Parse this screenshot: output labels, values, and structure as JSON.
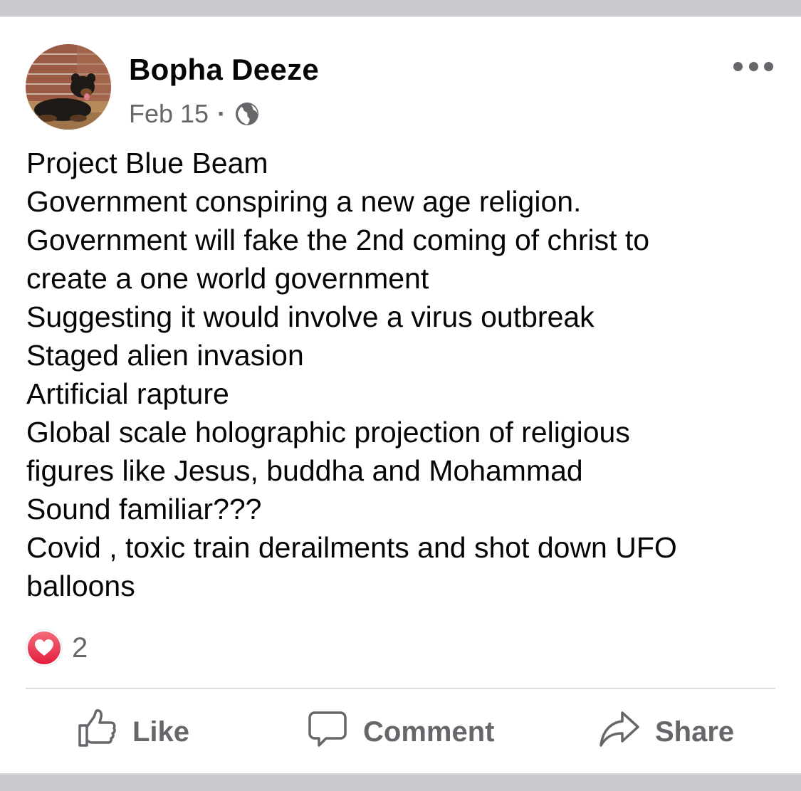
{
  "post": {
    "author": "Bopha Deeze",
    "date": "Feb 15",
    "separator": "·",
    "audience_icon": "globe-icon",
    "more_icon": "more-options-icon",
    "body_lines": [
      "Project Blue Beam",
      "Government conspiring a new age religion.",
      "Government will fake the 2nd coming of christ to",
      "create a one world government",
      "Suggesting it would involve a virus outbreak",
      "Staged alien invasion",
      "Artificial rapture",
      "Global scale holographic projection of religious",
      "figures like Jesus, buddha and Mohammad",
      "Sound familiar???",
      "Covid , toxic train derailments and shot down UFO",
      "balloons"
    ],
    "reactions": {
      "icon": "heart-icon",
      "count": "2"
    }
  },
  "actions": {
    "like_label": "Like",
    "comment_label": "Comment",
    "share_label": "Share"
  },
  "colors": {
    "text_primary": "#050505",
    "text_secondary": "#65676b",
    "heart": "#e41e3f",
    "divider": "#dadde1",
    "frame": "#c9cbd0"
  }
}
